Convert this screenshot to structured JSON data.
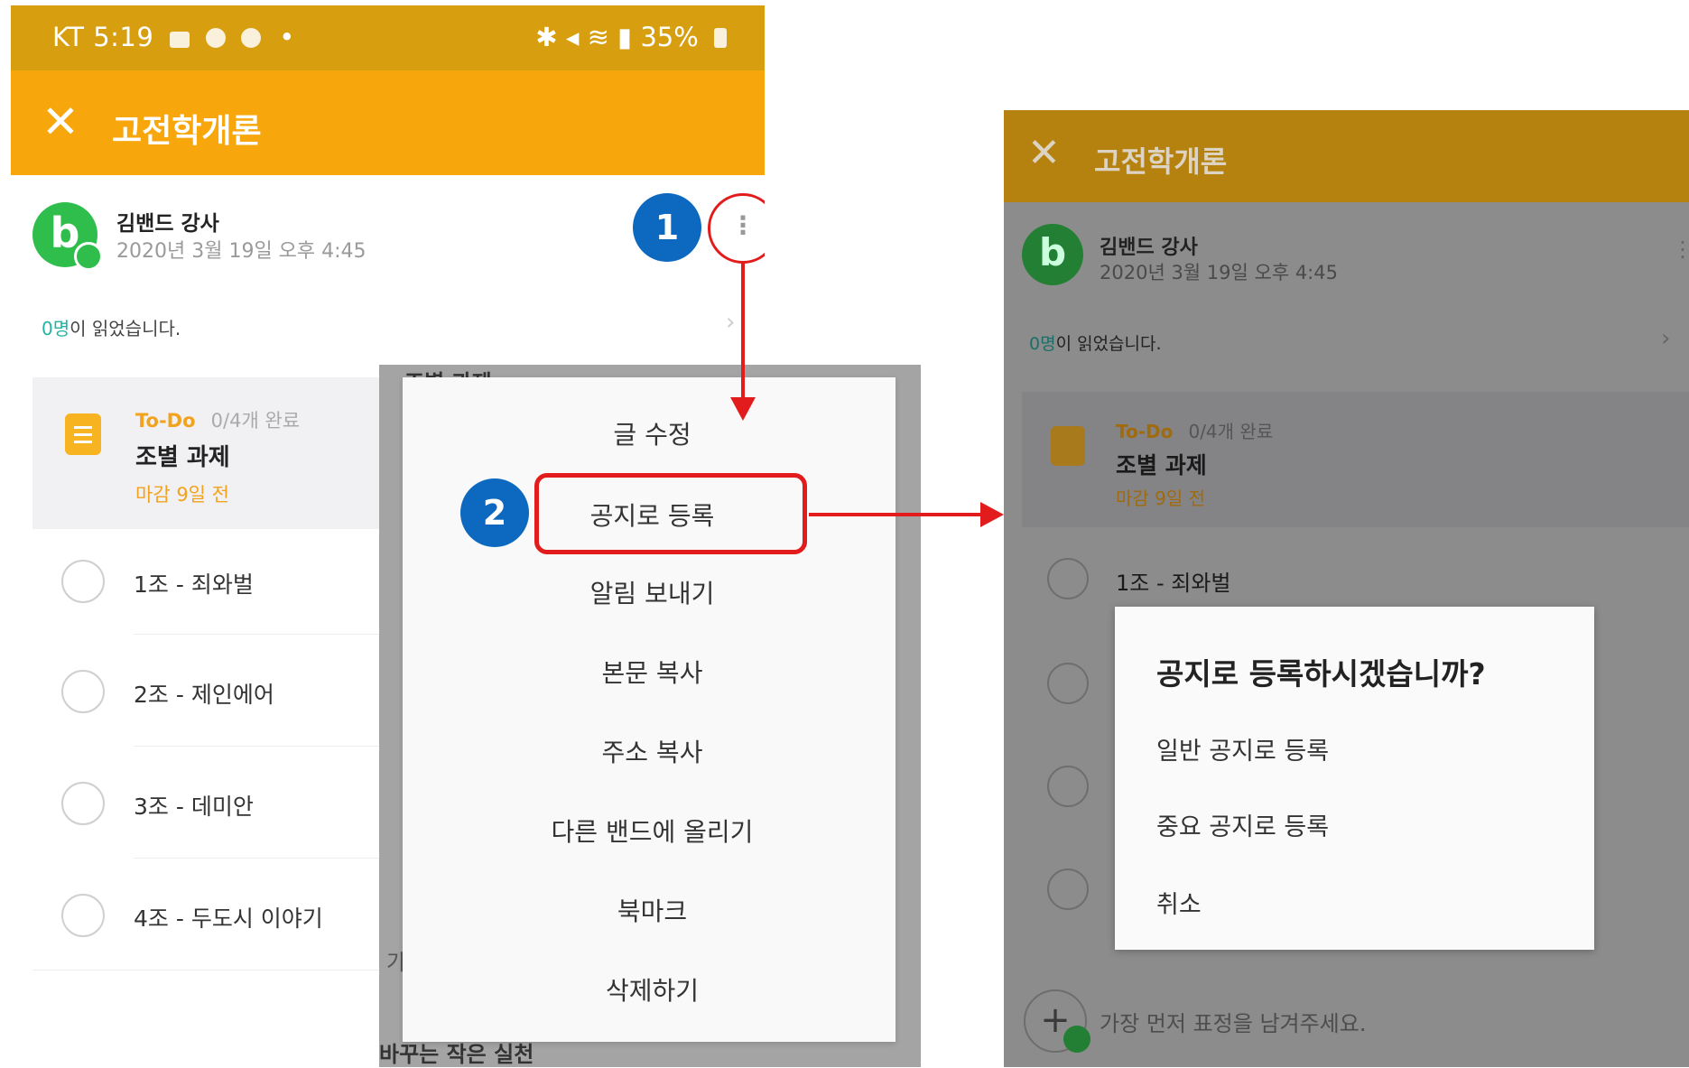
{
  "colors": {
    "status_bar": "#d79e10",
    "app_bar": "#f7a60b",
    "step_badge": "#0d69bf",
    "highlight": "#e21c1c",
    "avatar": "#2fbe4c",
    "todo_accent": "#f3a21d",
    "read_count": "#23b3a5"
  },
  "left": {
    "status": {
      "carrier_time": "KT 5:19",
      "battery": "35%",
      "icons": [
        "gallery-icon",
        "chat-icon",
        "band-icon",
        "mute-icon",
        "bluetooth-icon",
        "wifi-icon",
        "signal-icon",
        "battery-icon"
      ]
    },
    "header": {
      "close_icon": "close-icon",
      "title": "고전학개론"
    },
    "post": {
      "avatar_letter": "b",
      "author": "김밴드 강사",
      "date": "2020년 3월 19일 오후 4:45",
      "read_count": "0명",
      "read_suffix": "이 읽었습니다."
    },
    "step1": "1",
    "step2": "2",
    "todo": {
      "tag": "To-Do",
      "progress": "0/4개 완료",
      "title": "조별 과제",
      "due": "마감 9일 전"
    },
    "tasks": [
      "1조 - 죄와벌",
      "2조 - 제인에어",
      "3조 - 데미안",
      "4조 - 두도시 이야기"
    ],
    "menu": [
      "글 수정",
      "공지로 등록",
      "알림 보내기",
      "본문 복사",
      "주소 복사",
      "다른 밴드에 올리기",
      "북마크",
      "삭제하기"
    ],
    "peek_top": "조별 과제",
    "peek_bottom": "바꾸는 작은 실천",
    "peek_side": "가"
  },
  "right": {
    "header": {
      "title": "고전학개론"
    },
    "post": {
      "avatar_letter": "b",
      "author": "김밴드 강사",
      "date": "2020년 3월 19일 오후 4:45",
      "read_count": "0명",
      "read_suffix": "이 읽었습니다."
    },
    "todo": {
      "tag": "To-Do",
      "progress": "0/4개 완료",
      "title": "조별 과제",
      "due": "마감 9일 전"
    },
    "first_task": "1조 - 죄와벌",
    "dialog": {
      "title": "공지로 등록하시겠습니까?",
      "options": [
        "일반 공지로 등록",
        "중요 공지로 등록",
        "취소"
      ]
    },
    "comment_placeholder": "가장 먼저 표정을 남겨주세요."
  }
}
